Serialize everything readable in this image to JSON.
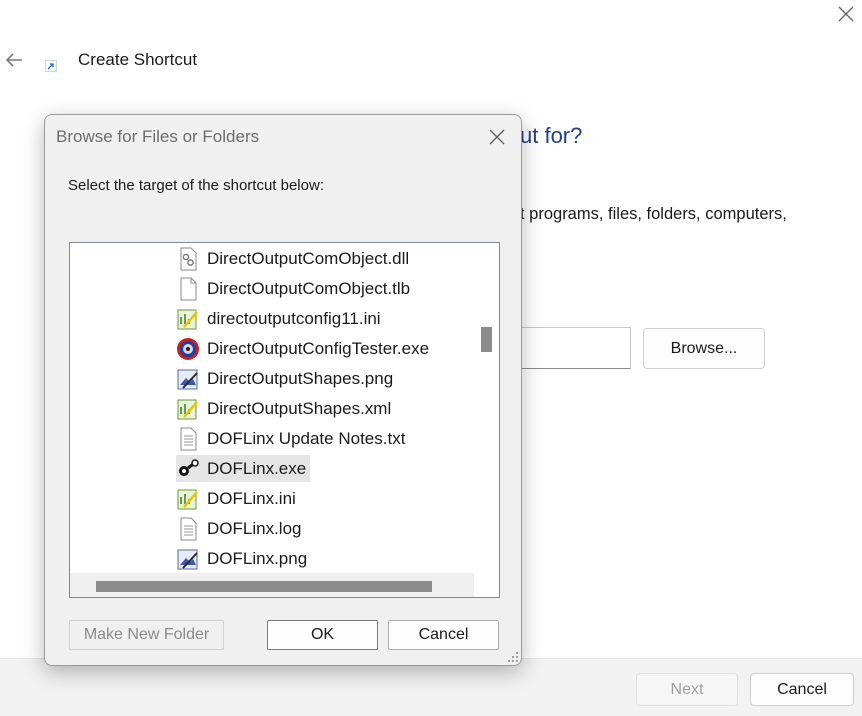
{
  "wizard": {
    "title": "Create Shortcut",
    "question_fragment": "ut for?",
    "description_fragment": "t programs, files, folders, computers,",
    "browse_label": "Browse...",
    "next_label": "Next",
    "cancel_label": "Cancel",
    "icons": {
      "close": "close-icon",
      "back": "back-arrow-icon",
      "shortcut": "shortcut-icon"
    }
  },
  "dialog": {
    "title": "Browse for Files or Folders",
    "instruction": "Select the target of the shortcut below:",
    "make_new_folder_label": "Make New Folder",
    "ok_label": "OK",
    "cancel_label": "Cancel",
    "items": [
      {
        "name": "DirectOutputComObject.dll",
        "icon": "dll-gear-icon"
      },
      {
        "name": "DirectOutputComObject.tlb",
        "icon": "blank-file-icon"
      },
      {
        "name": "directoutputconfig11.ini",
        "icon": "ini-notepad-icon"
      },
      {
        "name": "DirectOutputConfigTester.exe",
        "icon": "tester-app-icon"
      },
      {
        "name": "DirectOutputShapes.png",
        "icon": "image-file-icon"
      },
      {
        "name": "DirectOutputShapes.xml",
        "icon": "ini-notepad-icon"
      },
      {
        "name": "DOFLinx Update Notes.txt",
        "icon": "text-file-icon"
      },
      {
        "name": "DOFLinx.exe",
        "icon": "doflinx-app-icon",
        "selected": true
      },
      {
        "name": "DOFLinx.ini",
        "icon": "ini-notepad-icon"
      },
      {
        "name": "DOFLinx.log",
        "icon": "text-file-icon"
      },
      {
        "name": "DOFLinx.png",
        "icon": "image-file-icon"
      }
    ]
  }
}
